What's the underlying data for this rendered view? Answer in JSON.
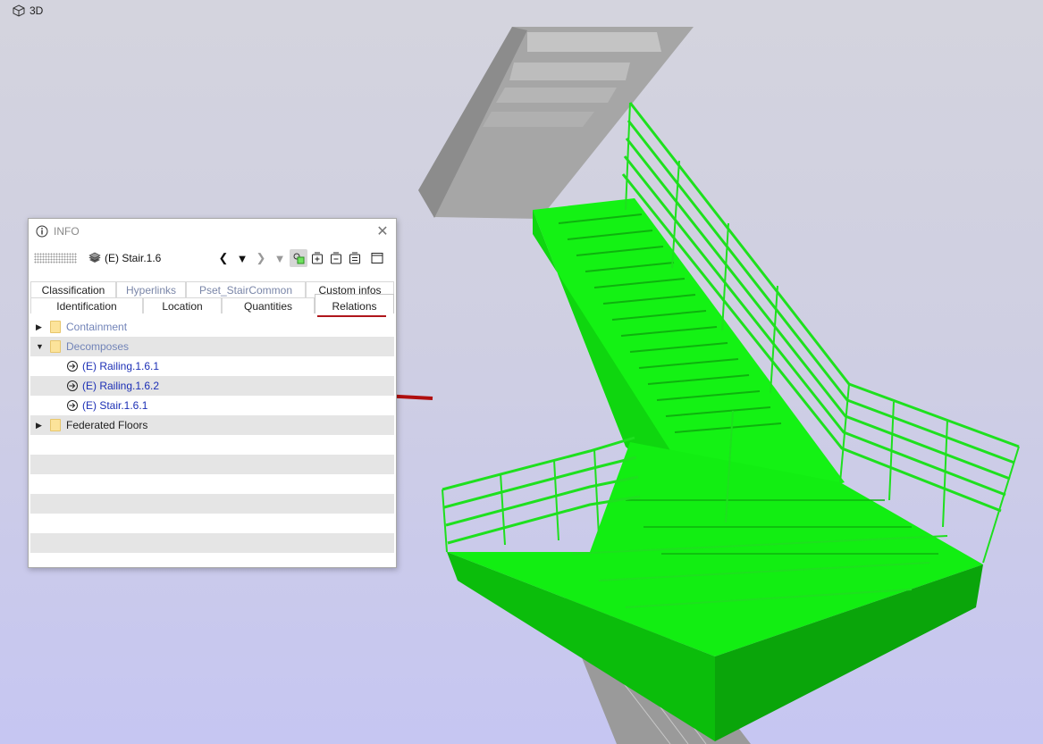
{
  "viewport": {
    "label": "3D"
  },
  "colors": {
    "accent": "#b0161b",
    "selection": "#1cff1c",
    "concrete": "#a3a3a3"
  },
  "info_panel": {
    "title": "INFO",
    "close_icon": "close-icon",
    "object_name": "(E) Stair.1.6",
    "toolbar_icons": [
      "back-icon",
      "dropdown-icon",
      "forward-icon",
      "dropdown-icon",
      "select-3d-icon",
      "expand-icon",
      "collapse-icon",
      "list-icon",
      "window-icon"
    ],
    "tabs_top": [
      "Classification",
      "Hyperlinks",
      "Pset_StairCommon",
      "Custom infos"
    ],
    "tabs_bottom": [
      "Identification",
      "Location",
      "Quantities",
      "Relations"
    ],
    "active_tab": "Relations",
    "tree": {
      "containment": "Containment",
      "decomposes": "Decomposes",
      "children": [
        "(E) Railing.1.6.1",
        "(E) Railing.1.6.2",
        "(E) Stair.1.6.1"
      ],
      "federated": "Federated Floors"
    }
  }
}
